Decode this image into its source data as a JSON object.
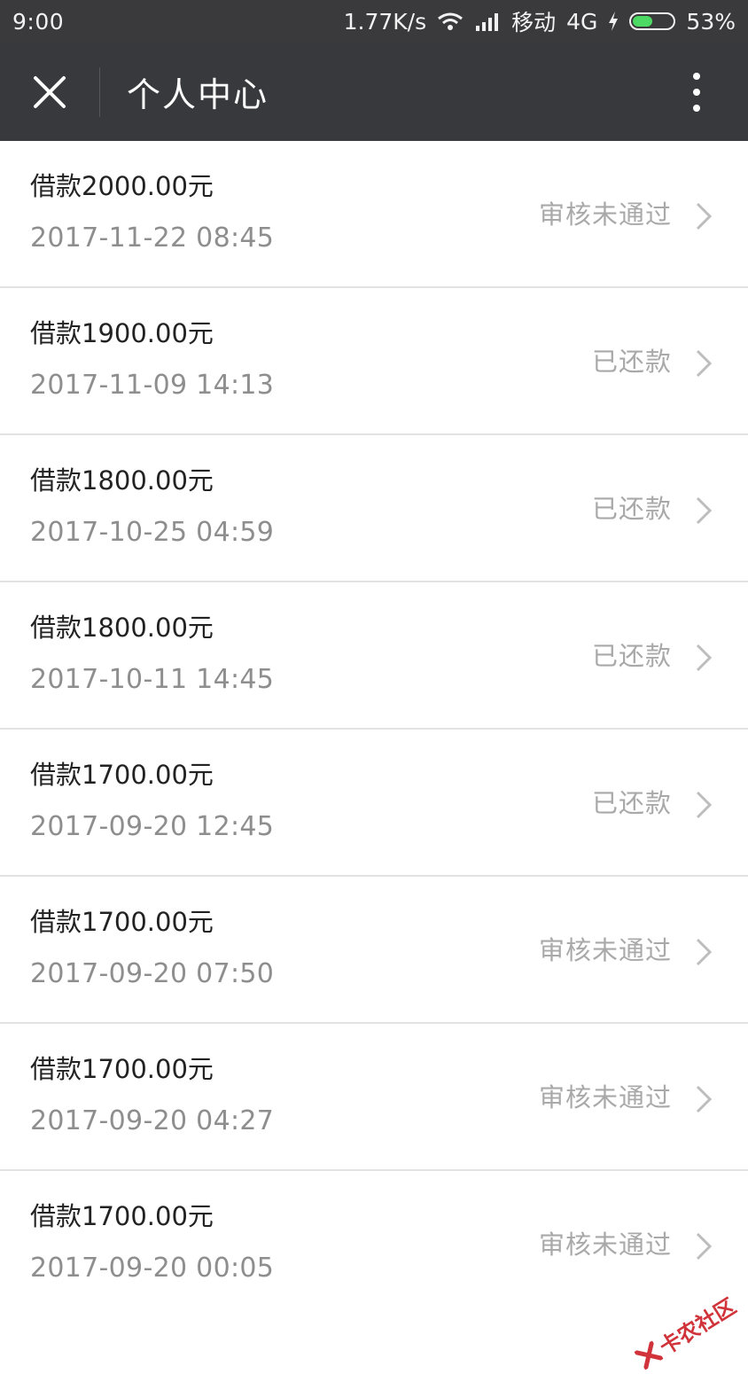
{
  "status_bar": {
    "time": "9:00",
    "net_speed": "1.77K/s",
    "carrier": "移动",
    "network": "4G",
    "battery": "53%",
    "battery_level": 0.53,
    "accent": "#4cd964"
  },
  "header": {
    "title": "个人中心",
    "close_icon": "close-icon",
    "more_icon": "more-vertical-icon"
  },
  "records": [
    {
      "amount": "借款2000.00元",
      "time": "2017-11-22 08:45",
      "status": "审核未通过"
    },
    {
      "amount": "借款1900.00元",
      "time": "2017-11-09 14:13",
      "status": "已还款"
    },
    {
      "amount": "借款1800.00元",
      "time": "2017-10-25 04:59",
      "status": "已还款"
    },
    {
      "amount": "借款1800.00元",
      "time": "2017-10-11 14:45",
      "status": "已还款"
    },
    {
      "amount": "借款1700.00元",
      "time": "2017-09-20 12:45",
      "status": "已还款"
    },
    {
      "amount": "借款1700.00元",
      "time": "2017-09-20 07:50",
      "status": "审核未通过"
    },
    {
      "amount": "借款1700.00元",
      "time": "2017-09-20 04:27",
      "status": "审核未通过"
    },
    {
      "amount": "借款1700.00元",
      "time": "2017-09-20 00:05",
      "status": "审核未通过"
    }
  ],
  "watermark": {
    "text": "卡农社区"
  }
}
